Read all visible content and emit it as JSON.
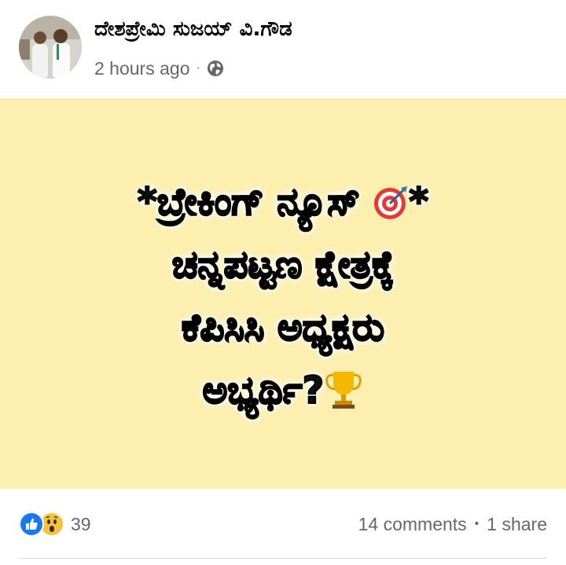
{
  "post": {
    "author_name": "ದೇಶಪ್ರೇಮಿ ಸುಜಯ್ ವಿ.ಗೌಡ",
    "timestamp": "2 hours ago",
    "separator": "·",
    "privacy_icon": "globe-icon",
    "avatar_icon": "profile-photo"
  },
  "card": {
    "background_color": "#fcefaf",
    "lines": [
      "*ಬ್ರೇಕಿಂಗ್ ನ್ಯೂಸ್",
      "ಚನ್ನಪಟ್ಟಣ ಕ್ಷೇತ್ರಕ್ಕೆ",
      "ಕೆಪಿಸಿಸಿ ಅಧ್ಯಕ್ಷರು",
      "ಅಭ್ಯರ್ಥಿ?"
    ],
    "line1_suffix": "*",
    "emojis": [
      "direct-hit-emoji",
      "trophy-emoji"
    ]
  },
  "footer": {
    "reaction_icons": [
      "like-icon",
      "wow-icon"
    ],
    "reaction_count": "39",
    "comments": "14 comments",
    "dot": "•",
    "shares": "1 share"
  },
  "colors": {
    "like_blue": "#1877f2",
    "wow_yellow": "#f7c23b",
    "meta_gray": "#65676b"
  }
}
